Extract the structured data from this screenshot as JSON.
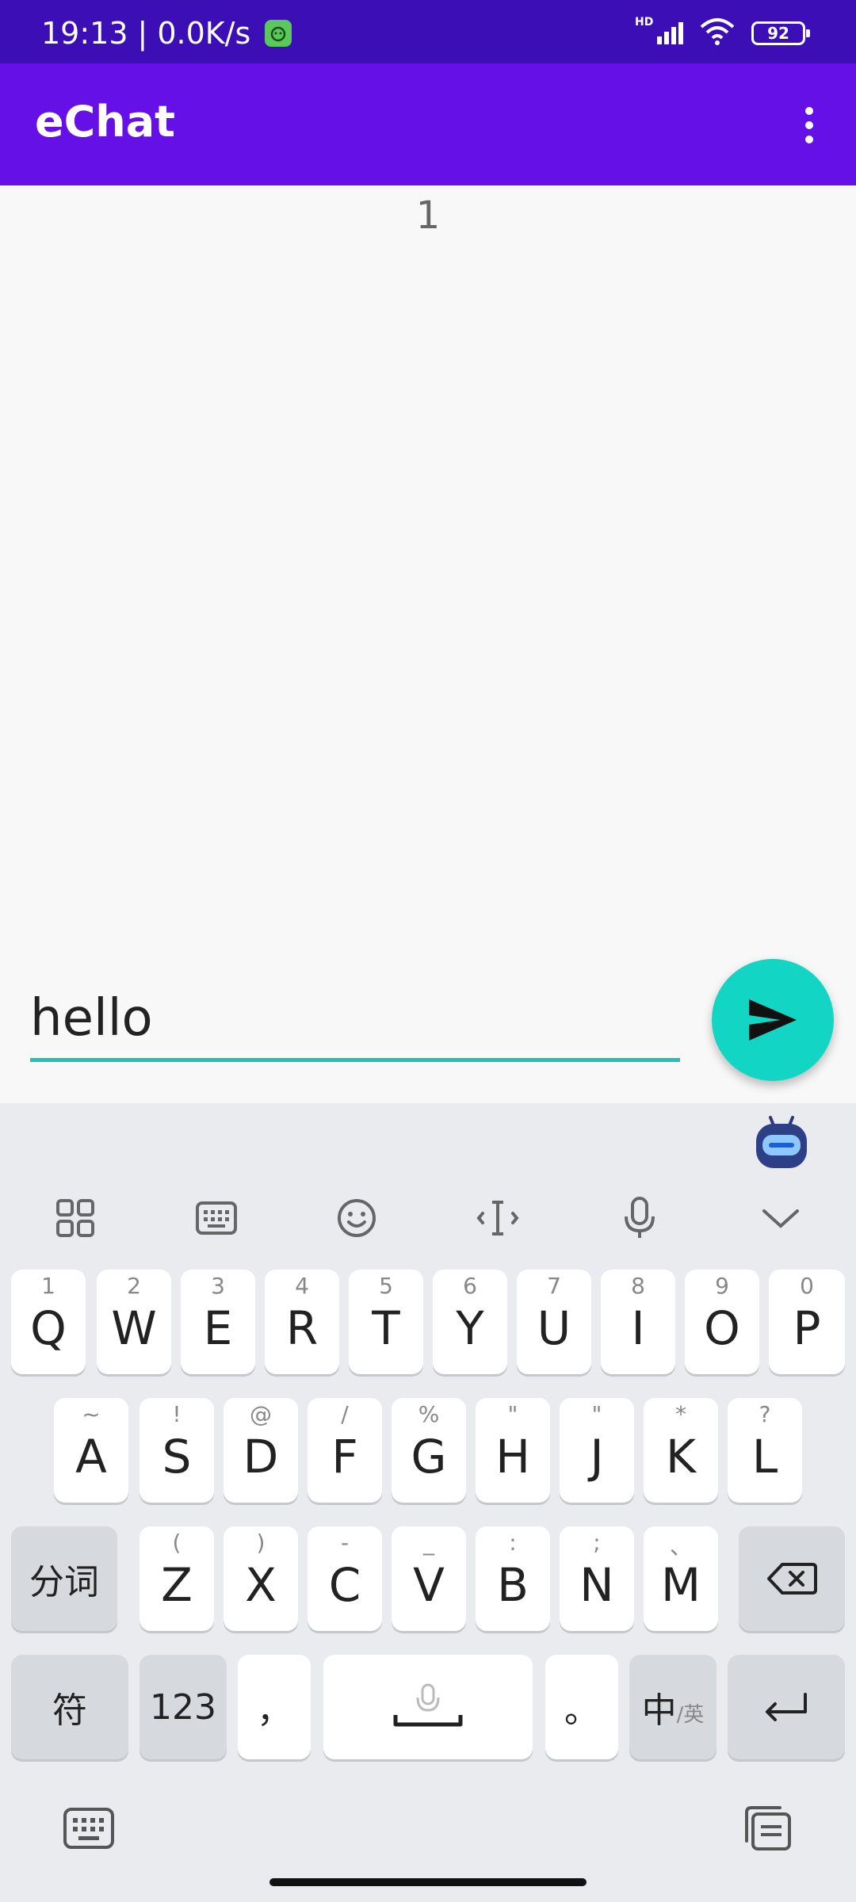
{
  "status_bar": {
    "time": "19:13",
    "separator": "|",
    "net_speed": "0.0K/s",
    "network_type": "HD",
    "battery": "92"
  },
  "app_bar": {
    "title": "eChat"
  },
  "chat": {
    "messages": [
      "1"
    ]
  },
  "input": {
    "value": "hello"
  },
  "keyboard": {
    "row1": [
      {
        "hint": "1",
        "key": "Q"
      },
      {
        "hint": "2",
        "key": "W"
      },
      {
        "hint": "3",
        "key": "E"
      },
      {
        "hint": "4",
        "key": "R"
      },
      {
        "hint": "5",
        "key": "T"
      },
      {
        "hint": "6",
        "key": "Y"
      },
      {
        "hint": "7",
        "key": "U"
      },
      {
        "hint": "8",
        "key": "I"
      },
      {
        "hint": "9",
        "key": "O"
      },
      {
        "hint": "0",
        "key": "P"
      }
    ],
    "row2": [
      {
        "hint": "~",
        "key": "A"
      },
      {
        "hint": "!",
        "key": "S"
      },
      {
        "hint": "@",
        "key": "D"
      },
      {
        "hint": "/",
        "key": "F"
      },
      {
        "hint": "%",
        "key": "G"
      },
      {
        "hint": "\"",
        "key": "H"
      },
      {
        "hint": "\"",
        "key": "J"
      },
      {
        "hint": "*",
        "key": "K"
      },
      {
        "hint": "?",
        "key": "L"
      }
    ],
    "row3": [
      {
        "hint": "(",
        "key": "Z"
      },
      {
        "hint": ")",
        "key": "X"
      },
      {
        "hint": "-",
        "key": "C"
      },
      {
        "hint": "_",
        "key": "V"
      },
      {
        "hint": ":",
        "key": "B"
      },
      {
        "hint": ";",
        "key": "N"
      },
      {
        "hint": "、",
        "key": "M"
      }
    ],
    "segment_label": "分词",
    "symbols_label": "符",
    "numbers_label": "123",
    "comma_label": "，",
    "period_label": "。",
    "lang_primary": "中",
    "lang_secondary": "/英"
  }
}
